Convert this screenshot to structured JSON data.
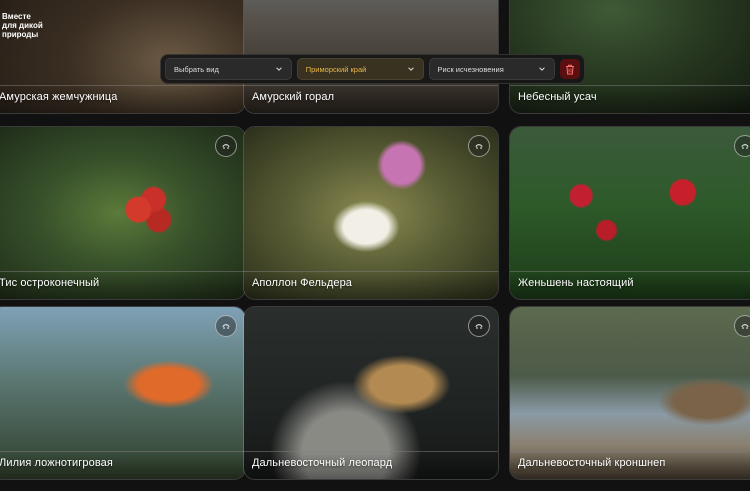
{
  "brand": {
    "logo_lines": [
      "Вместе",
      "для дикой",
      "природы"
    ]
  },
  "filters": {
    "species": "Выбрать вид",
    "region": "Приморский край",
    "risk": "Риск исчезновения",
    "accent_color": "#e8b74a",
    "clear_icon": "trash-icon"
  },
  "cards": [
    {
      "label": "Амурская жемчужница",
      "action_icon": ""
    },
    {
      "label": "Амурский горал",
      "action_icon": ""
    },
    {
      "label": "Небесный усач",
      "action_icon": ""
    },
    {
      "label": "Тис остроконечный",
      "action_icon": "hand-icon"
    },
    {
      "label": "Аполлон Фельдера",
      "action_icon": "hand-icon"
    },
    {
      "label": "Женьшень настоящий",
      "action_icon": "hand-icon"
    },
    {
      "label": "Лилия ложнотигровая",
      "action_icon": "hand-icon"
    },
    {
      "label": "Дальневосточный леопард",
      "action_icon": "hand-icon"
    },
    {
      "label": "Дальневосточный кроншнеп",
      "action_icon": "hand-icon"
    }
  ]
}
